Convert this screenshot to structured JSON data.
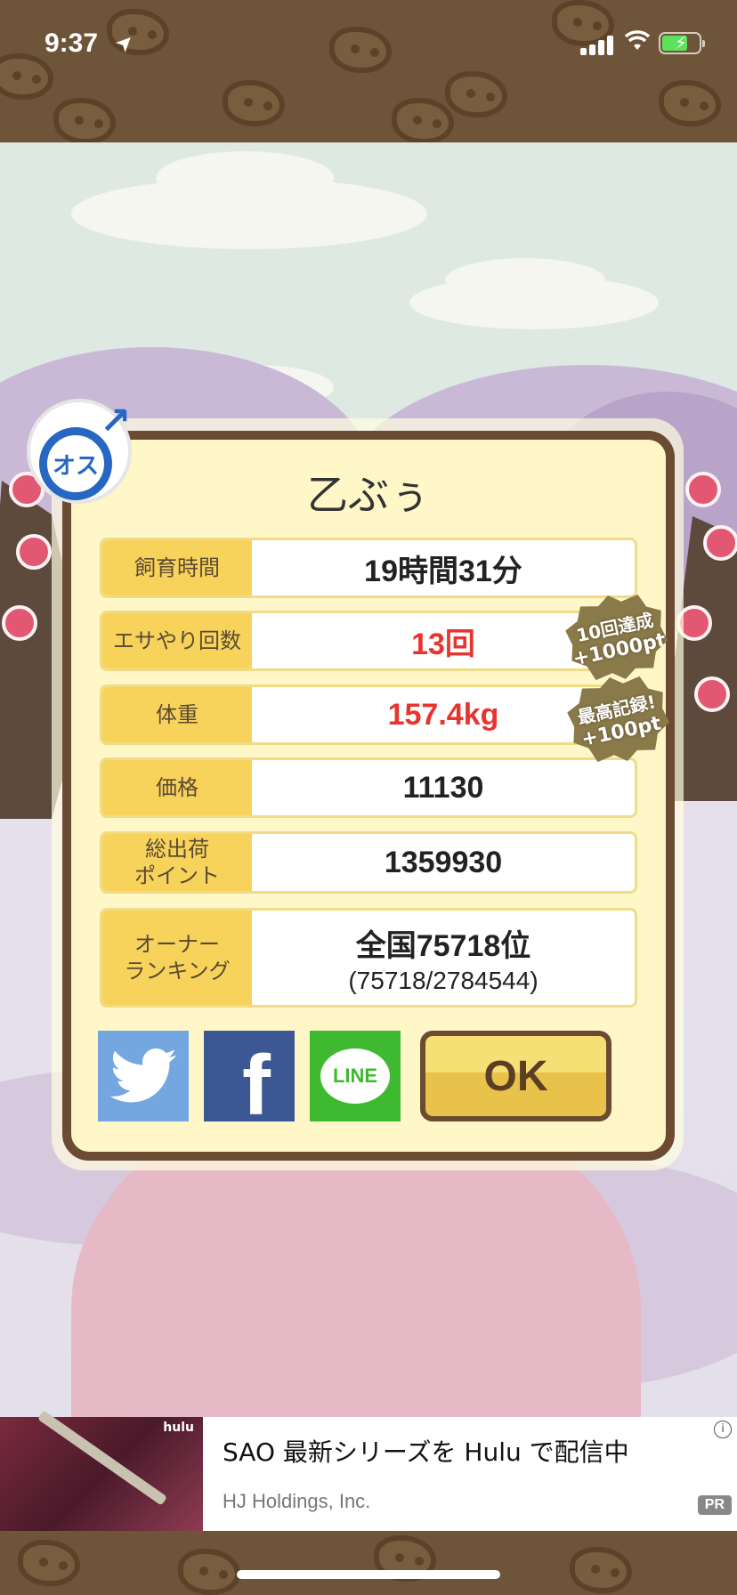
{
  "status_bar": {
    "time": "9:37",
    "location_glyph": "➤",
    "battery_bolt": "⚡"
  },
  "gender": {
    "label": "オス",
    "symbol": "↗",
    "icon": "male-icon",
    "color": "#2867c1"
  },
  "pet": {
    "name": "乙ぶぅ"
  },
  "stats": [
    {
      "label": "飼育時間",
      "value": "19時間31分",
      "highlight": false
    },
    {
      "label": "エサやり回数",
      "value": "13回",
      "highlight": true
    },
    {
      "label": "体重",
      "value": "157.4kg",
      "highlight": true
    },
    {
      "label": "価格",
      "value": "11130",
      "highlight": false
    },
    {
      "label": "総出荷\nポイント",
      "value": "1359930",
      "highlight": false
    },
    {
      "label": "オーナー\nランキング",
      "value": "全国75718位",
      "sub": "(75718/2784544)",
      "highlight": false
    }
  ],
  "awards": [
    {
      "line1": "10回達成",
      "line2": "+1000pt"
    },
    {
      "line1": "最高記録!",
      "line2": "+100pt"
    }
  ],
  "share": {
    "twitter_icon": "twitter-icon",
    "facebook_label": "f",
    "line_label": "LINE"
  },
  "ok_button": {
    "label": "OK"
  },
  "ad": {
    "brand": "hulu",
    "title": "SAO 最新シリーズを Hulu で配信中",
    "advertiser": "HJ Holdings, Inc.",
    "info_glyph": "i",
    "pr_badge": "PR"
  },
  "colors": {
    "brown": "#6b4b31",
    "label_bg": "#f8d35b",
    "value_red": "#e8342e",
    "dialog_bg": "#fff7c8"
  }
}
